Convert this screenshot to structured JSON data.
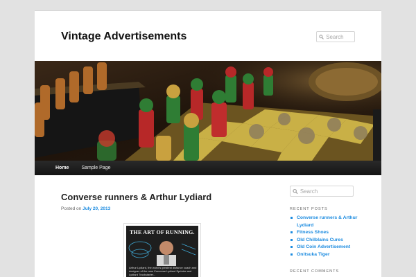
{
  "site": {
    "title": "Vintage Advertisements"
  },
  "search": {
    "placeholder": "Search"
  },
  "nav": {
    "items": [
      {
        "label": "Home",
        "current": true
      },
      {
        "label": "Sample Page",
        "current": false
      }
    ]
  },
  "post": {
    "title": "Converse runners & Arthur Lydiard",
    "posted_on_label": "Posted on",
    "date": "July 20, 2013",
    "image": {
      "headline": "THE ART OF RUNNING.",
      "caption": "Arthur Lydiard, the world's greatest distance coach and designer of the new Converse Lydiard Sprinter and Lydiard Trackstarter..."
    }
  },
  "sidebar": {
    "recent_posts": {
      "title": "RECENT POSTS",
      "items": [
        "Converse runners & Arthur Lydiard",
        "Fitness Shoes",
        "Old Chilblains Cures",
        "Old Coin Advertisement",
        "Onitsuka Tiger"
      ]
    },
    "recent_comments": {
      "title": "RECENT COMMENTS"
    }
  },
  "colors": {
    "link": "#1b8be0",
    "nav_bg": "#1c1c1c",
    "page_bg": "#e2e2e2"
  }
}
